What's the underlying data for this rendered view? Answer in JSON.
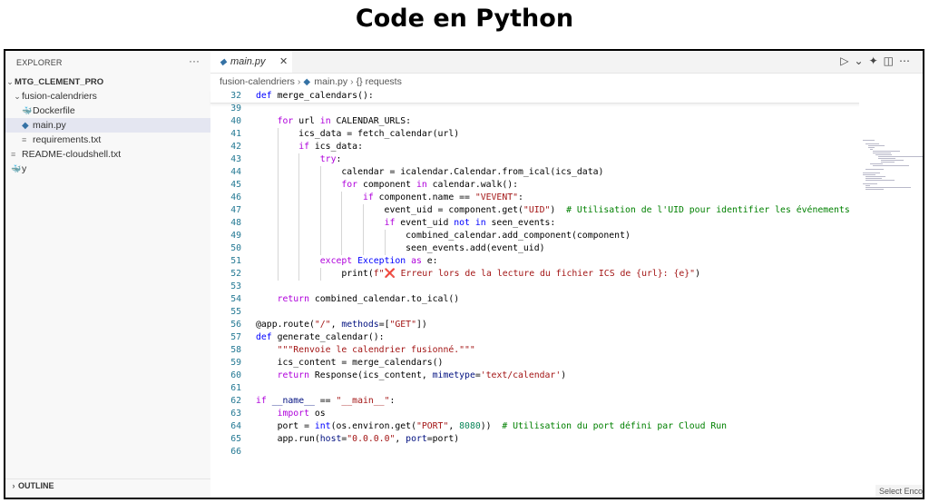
{
  "banner_title": "Code en Python",
  "explorer": {
    "header": "EXPLORER",
    "more": "···",
    "root": "MTG_CLEMENT_PRO",
    "items": [
      {
        "label": "fusion-calendriers"
      },
      {
        "label": "Dockerfile"
      },
      {
        "label": "main.py"
      },
      {
        "label": "requirements.txt"
      },
      {
        "label": "README-cloudshell.txt"
      },
      {
        "label": "y"
      }
    ],
    "outline": "OUTLINE"
  },
  "editor": {
    "tab_label": "main.py",
    "tab_close": "✕",
    "breadcrumb": {
      "folder": "fusion-calendriers",
      "file": "main.py",
      "symbol": "{} requests"
    },
    "status_hint": "Select Enco"
  },
  "code_lines": [
    {
      "n": "32",
      "tokens": [
        [
          "kw",
          "def"
        ],
        [
          "plain",
          " "
        ],
        [
          "fn",
          "merge_calendars"
        ],
        [
          "plain",
          "():"
        ]
      ]
    },
    {
      "n": "39",
      "tokens": []
    },
    {
      "n": "40",
      "tokens": [
        [
          "plain",
          "    "
        ],
        [
          "ctl",
          "for"
        ],
        [
          "plain",
          " url "
        ],
        [
          "ctl",
          "in"
        ],
        [
          "plain",
          " CALENDAR_URLS:"
        ]
      ]
    },
    {
      "n": "41",
      "tokens": [
        [
          "plain",
          "        ics_data = fetch_calendar(url)"
        ]
      ]
    },
    {
      "n": "42",
      "tokens": [
        [
          "plain",
          "        "
        ],
        [
          "ctl",
          "if"
        ],
        [
          "plain",
          " ics_data:"
        ]
      ]
    },
    {
      "n": "43",
      "tokens": [
        [
          "plain",
          "            "
        ],
        [
          "ctl",
          "try"
        ],
        [
          "plain",
          ":"
        ]
      ]
    },
    {
      "n": "44",
      "tokens": [
        [
          "plain",
          "                calendar = icalendar.Calendar.from_ical(ics_data)"
        ]
      ]
    },
    {
      "n": "45",
      "tokens": [
        [
          "plain",
          "                "
        ],
        [
          "ctl",
          "for"
        ],
        [
          "plain",
          " component "
        ],
        [
          "ctl",
          "in"
        ],
        [
          "plain",
          " calendar.walk():"
        ]
      ]
    },
    {
      "n": "46",
      "tokens": [
        [
          "plain",
          "                    "
        ],
        [
          "ctl",
          "if"
        ],
        [
          "plain",
          " component.name == "
        ],
        [
          "str",
          "\"VEVENT\""
        ],
        [
          "plain",
          ":"
        ]
      ]
    },
    {
      "n": "47",
      "tokens": [
        [
          "plain",
          "                        event_uid = component.get("
        ],
        [
          "str",
          "\"UID\""
        ],
        [
          "plain",
          ")  "
        ],
        [
          "cmt",
          "# Utilisation de l'UID pour identifier les événements"
        ]
      ]
    },
    {
      "n": "48",
      "tokens": [
        [
          "plain",
          "                        "
        ],
        [
          "ctl",
          "if"
        ],
        [
          "plain",
          " event_uid "
        ],
        [
          "kw",
          "not in"
        ],
        [
          "plain",
          " seen_events:"
        ]
      ]
    },
    {
      "n": "49",
      "tokens": [
        [
          "plain",
          "                            combined_calendar.add_component(component)"
        ]
      ]
    },
    {
      "n": "50",
      "tokens": [
        [
          "plain",
          "                            seen_events.add(event_uid)"
        ]
      ]
    },
    {
      "n": "51",
      "tokens": [
        [
          "plain",
          "            "
        ],
        [
          "ctl",
          "except"
        ],
        [
          "plain",
          " "
        ],
        [
          "cls",
          "Exception"
        ],
        [
          "plain",
          " "
        ],
        [
          "ctl",
          "as"
        ],
        [
          "plain",
          " e:"
        ]
      ]
    },
    {
      "n": "52",
      "tokens": [
        [
          "plain",
          "                print("
        ],
        [
          "str",
          "f\"❌ Erreur lors de la lecture du fichier ICS de {url}: {e}\""
        ],
        [
          "plain",
          ")"
        ]
      ]
    },
    {
      "n": "53",
      "tokens": []
    },
    {
      "n": "54",
      "tokens": [
        [
          "plain",
          "    "
        ],
        [
          "ctl",
          "return"
        ],
        [
          "plain",
          " combined_calendar.to_ical()"
        ]
      ]
    },
    {
      "n": "55",
      "tokens": []
    },
    {
      "n": "56",
      "tokens": [
        [
          "plain",
          "@app.route("
        ],
        [
          "str",
          "\"/\""
        ],
        [
          "plain",
          ", "
        ],
        [
          "param",
          "methods"
        ],
        [
          "plain",
          "=["
        ],
        [
          "str",
          "\"GET\""
        ],
        [
          "plain",
          "])"
        ]
      ]
    },
    {
      "n": "57",
      "tokens": [
        [
          "kw",
          "def"
        ],
        [
          "plain",
          " generate_calendar():"
        ]
      ]
    },
    {
      "n": "58",
      "tokens": [
        [
          "plain",
          "    "
        ],
        [
          "str",
          "\"\"\"Renvoie le calendrier fusionné.\"\"\""
        ]
      ]
    },
    {
      "n": "59",
      "tokens": [
        [
          "plain",
          "    ics_content = merge_calendars()"
        ]
      ]
    },
    {
      "n": "60",
      "tokens": [
        [
          "plain",
          "    "
        ],
        [
          "ctl",
          "return"
        ],
        [
          "plain",
          " Response(ics_content, "
        ],
        [
          "param",
          "mimetype"
        ],
        [
          "plain",
          "="
        ],
        [
          "str",
          "'text/calendar'"
        ],
        [
          "plain",
          ")"
        ]
      ]
    },
    {
      "n": "61",
      "tokens": []
    },
    {
      "n": "62",
      "tokens": [
        [
          "ctl",
          "if"
        ],
        [
          "plain",
          " "
        ],
        [
          "param",
          "__name__"
        ],
        [
          "plain",
          " == "
        ],
        [
          "str",
          "\"__main__\""
        ],
        [
          "plain",
          ":"
        ]
      ]
    },
    {
      "n": "63",
      "tokens": [
        [
          "plain",
          "    "
        ],
        [
          "ctl",
          "import"
        ],
        [
          "plain",
          " os"
        ]
      ]
    },
    {
      "n": "64",
      "tokens": [
        [
          "plain",
          "    port = "
        ],
        [
          "kw",
          "int"
        ],
        [
          "plain",
          "(os.environ.get("
        ],
        [
          "str",
          "\"PORT\""
        ],
        [
          "plain",
          ", "
        ],
        [
          "num",
          "8080"
        ],
        [
          "plain",
          "))  "
        ],
        [
          "cmt",
          "# Utilisation du port défini par Cloud Run"
        ]
      ]
    },
    {
      "n": "65",
      "tokens": [
        [
          "plain",
          "    app.run("
        ],
        [
          "param",
          "host"
        ],
        [
          "plain",
          "="
        ],
        [
          "str",
          "\"0.0.0.0\""
        ],
        [
          "plain",
          ", "
        ],
        [
          "param",
          "port"
        ],
        [
          "plain",
          "=port)"
        ]
      ]
    },
    {
      "n": "66",
      "tokens": []
    }
  ],
  "colors": {
    "keyword": "#0000ff",
    "control": "#af00db",
    "string": "#a31515",
    "comment": "#008000",
    "number": "#098658",
    "line_number": "#237893",
    "selected_row": "#e4e6f1"
  }
}
